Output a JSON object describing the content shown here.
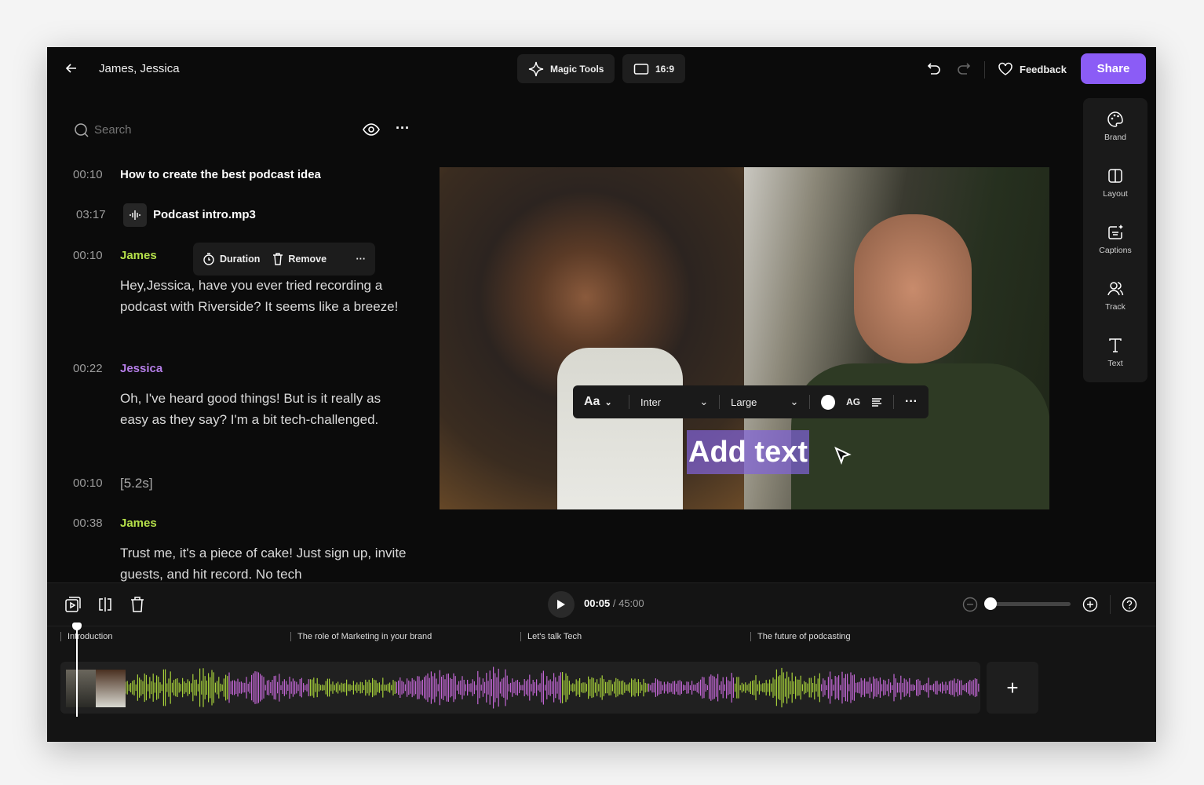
{
  "header": {
    "title": "James, Jessica",
    "magic_tools": "Magic Tools",
    "aspect": "16:9",
    "feedback": "Feedback",
    "share": "Share",
    "accent": "#8b5cf6"
  },
  "transcript": {
    "search_placeholder": "Search",
    "chapter": {
      "time": "00:10",
      "title": "How to create the best podcast idea"
    },
    "audio": {
      "time": "03:17",
      "file": "Podcast intro.mp3"
    },
    "context_menu": {
      "duration": "Duration",
      "remove": "Remove"
    },
    "entries": [
      {
        "time": "00:10",
        "speaker": "James",
        "text": "Hey,Jessica, have you ever tried recording a podcast with Riverside? It seems like a breeze!"
      },
      {
        "time": "00:22",
        "speaker": "Jessica",
        "text": "Oh, I've heard good things! But is it really as easy as they say? I'm a bit tech-challenged."
      },
      {
        "time": "00:10",
        "pause": "[5.2s]"
      },
      {
        "time": "00:38",
        "speaker": "James",
        "text": "Trust me, it's a piece of cake! Just sign up, invite guests, and hit record. No tech"
      }
    ],
    "speaker_colors": {
      "James": "#b5e04a",
      "Jessica": "#b57ee8"
    }
  },
  "text_toolbar": {
    "style": "Aa",
    "font": "Inter",
    "size": "Large",
    "case": "AG",
    "color": "#ffffff"
  },
  "canvas": {
    "overlay_text": "Add text"
  },
  "rail": [
    {
      "label": "Brand",
      "icon": "palette-icon"
    },
    {
      "label": "Layout",
      "icon": "layout-icon"
    },
    {
      "label": "Captions",
      "icon": "captions-icon"
    },
    {
      "label": "Track",
      "icon": "track-icon"
    },
    {
      "label": "Text",
      "icon": "text-icon"
    }
  ],
  "timeline": {
    "current": "00:05",
    "total": "/ 45:00",
    "zoom_level": 0.0,
    "chapters": [
      "Introduction",
      "The role of Marketing in your brand",
      "Let's talk Tech",
      "The future of podcasting"
    ],
    "wave_colors": {
      "james": "#a6cf3a",
      "jessica": "#c266d4"
    }
  }
}
